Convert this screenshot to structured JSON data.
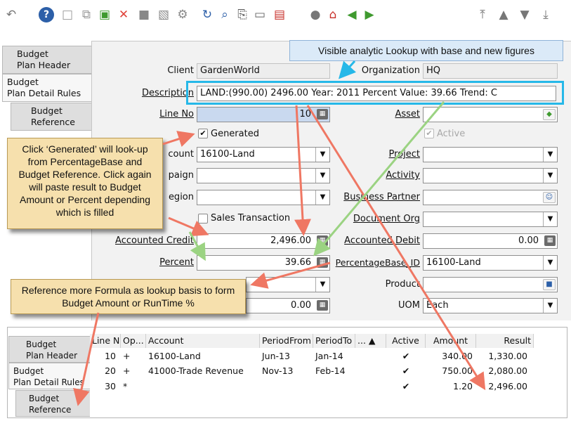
{
  "colors": {
    "toolbar_blue": "#2c5fa8",
    "toolbar_green": "#3f9a2f",
    "toolbar_red": "#c8302a",
    "callout_yellow": "#f6e0ad",
    "callout_blue": "#dbeaf8",
    "highlight_cyan": "#26b8e8",
    "arrow_red": "#ef7763",
    "arrow_green": "#9bd382"
  },
  "toolbar": {
    "icons": [
      "undo-icon",
      "help-icon",
      "new-record-icon",
      "copy-record-icon",
      "save-icon",
      "delete-icon",
      "save-as-icon",
      "print-icon",
      "settings-icon",
      "refresh-icon",
      "find-icon",
      "attachment-icon",
      "chat-icon",
      "grid-toggle-icon",
      "history-icon",
      "home-icon",
      "previous-icon",
      "next-icon",
      "first-record-icon",
      "previous-record-icon",
      "next-record-icon",
      "last-record-icon"
    ]
  },
  "tabs": [
    {
      "label": "Budget\nPlan Header"
    },
    {
      "label": "Budget\nPlan Detail Rules"
    },
    {
      "label": "Budget\nReference"
    }
  ],
  "form": {
    "client_label": "Client",
    "client_value": "GardenWorld",
    "organization_label": "Organization",
    "organization_value": "HQ",
    "description_label": "Description",
    "description_value": "LAND:(990.00) 2496.00 Year: 2011  Percent Value: 39.66 Trend: C",
    "line_no_label": "Line No",
    "line_no_value": "10",
    "asset_label": "Asset",
    "generated_label": "Generated",
    "generated_checked": true,
    "active_label": "Active",
    "active_checked": true,
    "account_label": "Account",
    "account_label_visible": "count",
    "account_value": "16100-Land",
    "project_label": "Project",
    "campaign_label_visible": "paign",
    "activity_label": "Activity",
    "region_label_visible": "egion",
    "business_partner_label": "Business Partner",
    "sales_transaction_label": "Sales Transaction",
    "document_org_label": "Document Org",
    "accounted_credit_label": "Accounted Credit",
    "accounted_credit_value": "2,496.00",
    "accounted_debit_label": "Accounted Debit",
    "accounted_debit_value": "0.00",
    "percent_label": "Percent",
    "percent_value": "39.66",
    "percentage_base_label": "PercentageBase_ID",
    "percentage_base_value": "16100-Land",
    "product_label": "Product",
    "qty_value": "0.00",
    "uom_label": "UOM",
    "uom_value": "Each"
  },
  "callouts": {
    "top": "Visible analytic Lookup with base and new figures",
    "generated": "Click ‘Generated’ will look-up from PercentageBase and Budget Reference. Click again will paste result to Budget Amount or Percent depending which is filled",
    "reference": "Reference more Formula as lookup basis to form Budget Amount or RunTime %"
  },
  "grid": {
    "headers": [
      "Line No",
      "Op...",
      "Account",
      "PeriodFrom",
      "PeriodTo",
      "...",
      "Active",
      "Amount",
      "Result"
    ],
    "rows": [
      {
        "line_no": "10",
        "op": "+",
        "account": "16100-Land",
        "period_from": "Jun-13",
        "period_to": "Jan-14",
        "active": "✔",
        "amount": "340.00",
        "result": "1,330.00"
      },
      {
        "line_no": "20",
        "op": "+",
        "account": "41000-Trade Revenue",
        "period_from": "Nov-13",
        "period_to": "Feb-14",
        "active": "✔",
        "amount": "750.00",
        "result": "2,080.00"
      },
      {
        "line_no": "30",
        "op": "*",
        "account": "",
        "period_from": "",
        "period_to": "",
        "active": "✔",
        "amount": "1.20",
        "result": "2,496.00"
      }
    ]
  }
}
